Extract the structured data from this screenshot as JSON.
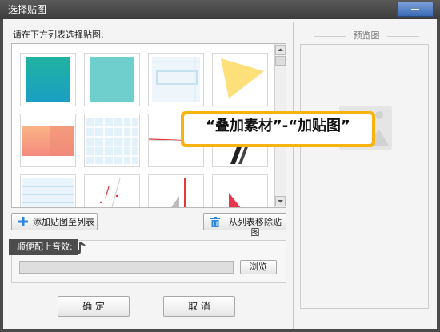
{
  "window": {
    "title": "选择贴图"
  },
  "list": {
    "label": "请在下方列表选择贴图:"
  },
  "buttons": {
    "add": "添加贴图至列表",
    "remove": "从列表移除贴图",
    "browse": "浏览",
    "ok": "确  定",
    "cancel": "取 消"
  },
  "sound": {
    "label": "顺便配上音效:",
    "path": ""
  },
  "preview": {
    "label": "预览图"
  },
  "callout": {
    "text": "“叠加素材”-“加贴图”"
  },
  "colors": {
    "accent": "#f7b411",
    "titlebar": "#3c3c3c",
    "add_icon": "#2e86de",
    "trash_icon": "#2e86de"
  },
  "icons": [
    "close-icon",
    "plus-icon",
    "trash-icon",
    "music-note-icon",
    "scroll-up-icon",
    "scroll-down-icon",
    "image-placeholder-icon"
  ]
}
